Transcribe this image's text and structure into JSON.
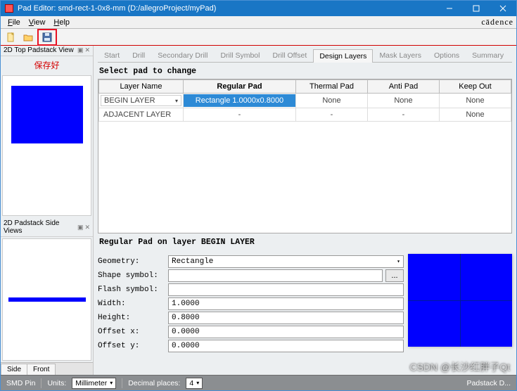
{
  "titlebar": {
    "title": "Pad Editor: smd-rect-1-0x8-mm   (D:/allegroProject/myPad)"
  },
  "menubar": {
    "file": "File",
    "view": "View",
    "help": "Help",
    "brand": "cādence"
  },
  "toolbar": {
    "annotation_cn": "保存好"
  },
  "left": {
    "top_title": "2D Top Padstack View",
    "side_title": "2D Padstack Side Views",
    "tab_side": "Side",
    "tab_front": "Front"
  },
  "tabs": {
    "start": "Start",
    "drill": "Drill",
    "secondary_drill": "Secondary Drill",
    "drill_symbol": "Drill Symbol",
    "drill_offset": "Drill Offset",
    "design_layers": "Design Layers",
    "mask_layers": "Mask Layers",
    "options": "Options",
    "summary": "Summary"
  },
  "design_layers": {
    "heading": "Select pad to change",
    "columns": {
      "layer_name": "Layer Name",
      "regular_pad": "Regular Pad",
      "thermal_pad": "Thermal Pad",
      "anti_pad": "Anti Pad",
      "keep_out": "Keep Out"
    },
    "rows": [
      {
        "layer_name": "BEGIN LAYER",
        "regular_pad": "Rectangle 1.0000x0.8000",
        "thermal_pad": "None",
        "anti_pad": "None",
        "keep_out": "None",
        "selected": true
      },
      {
        "layer_name": "ADJACENT LAYER",
        "regular_pad": "-",
        "thermal_pad": "-",
        "anti_pad": "-",
        "keep_out": "None",
        "disabled": true
      }
    ],
    "form_heading": "Regular Pad on layer BEGIN LAYER",
    "form": {
      "geometry_label": "Geometry:",
      "geometry_value": "Rectangle",
      "shape_symbol_label": "Shape symbol:",
      "shape_symbol_value": "",
      "flash_symbol_label": "Flash symbol:",
      "flash_symbol_value": "",
      "width_label": "Width:",
      "width_value": "1.0000",
      "height_label": "Height:",
      "height_value": "0.8000",
      "offsetx_label": "Offset x:",
      "offsetx_value": "0.0000",
      "offsety_label": "Offset y:",
      "offsety_value": "0.0000",
      "ellipsis": "..."
    }
  },
  "statusbar": {
    "smd_pin": "SMD Pin",
    "units_label": "Units:",
    "units_value": "Millimeter",
    "decimal_label": "Decimal places:",
    "decimal_value": "4",
    "right_text": "Padstack D..."
  },
  "watermark": "CSDN @长沙红胖子Qt"
}
